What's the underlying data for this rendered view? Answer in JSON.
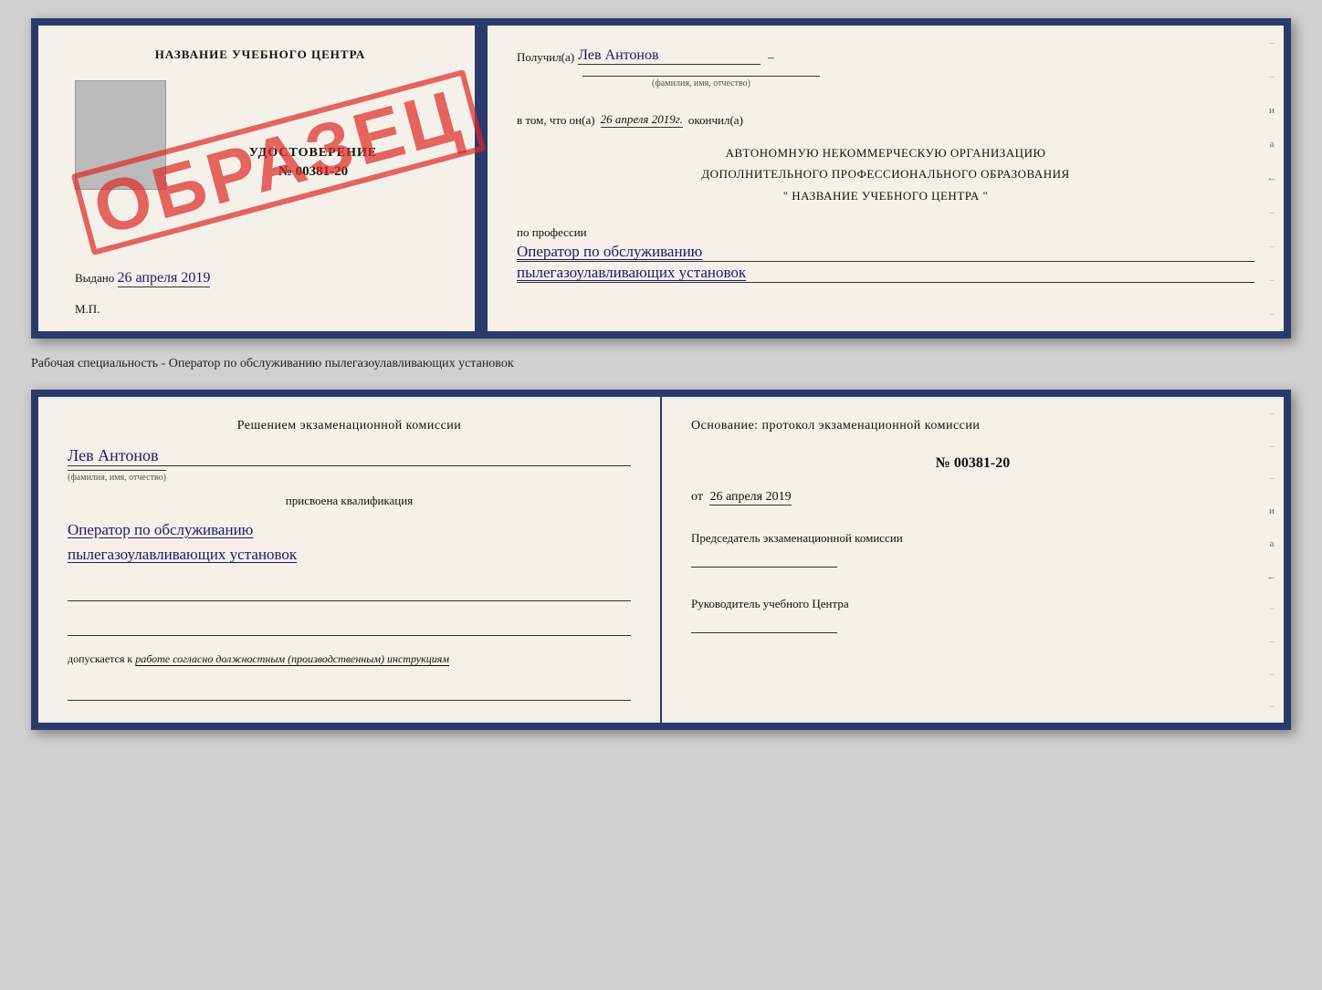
{
  "top_certificate": {
    "left_page": {
      "header": "НАЗВАНИЕ УЧЕБНОГО ЦЕНТРА",
      "photo_alt": "фото",
      "cert_title": "УДОСТОВЕРЕНИЕ",
      "cert_number": "№ 00381-20",
      "issued_label": "Выдано",
      "issued_date": "26 апреля 2019",
      "mp_label": "М.П.",
      "obrazets": "ОБРАЗЕЦ"
    },
    "right_page": {
      "received_prefix": "Получил(а)",
      "recipient_name": "Лев Антонов",
      "name_field_label": "(фамилия, имя, отчество)",
      "in_that_prefix": "в том, что он(а)",
      "completion_date": "26 апреля 2019г.",
      "completion_label": "окончил(а)",
      "org_line1": "АВТОНОМНУЮ НЕКОММЕРЧЕСКУЮ ОРГАНИЗАЦИЮ",
      "org_line2": "ДОПОЛНИТЕЛЬНОГО ПРОФЕССИОНАЛЬНОГО ОБРАЗОВАНИЯ",
      "org_line3": "\"   НАЗВАНИЕ УЧЕБНОГО ЦЕНТРА   \"",
      "profession_prefix": "по профессии",
      "profession_line1": "Оператор по обслуживанию",
      "profession_line2": "пылегазоулавливающих установок"
    }
  },
  "separator": {
    "text": "Рабочая специальность - Оператор по обслуживанию пылегазоулавливающих установок"
  },
  "bottom_certificate": {
    "left_page": {
      "commission_text": "Решением экзаменационной комиссии",
      "person_name": "Лев Антонов",
      "name_field_label": "(фамилия, имя, отчество)",
      "assigned_label": "присвоена квалификация",
      "qualification_line1": "Оператор по обслуживанию",
      "qualification_line2": "пылегазоулавливающих установок",
      "allowed_prefix": "допускается к",
      "allowed_italic": "работе согласно должностным (производственным) инструкциям"
    },
    "right_page": {
      "basis_label": "Основание: протокол экзаменационной комиссии",
      "protocol_number": "№  00381-20",
      "protocol_date_prefix": "от",
      "protocol_date": "26 апреля 2019",
      "chairman_label": "Председатель экзаменационной комиссии",
      "head_label": "Руководитель учебного Центра"
    }
  },
  "side_chars": {
    "u_char": "и",
    "a_char": "а",
    "left_arrow": "←"
  }
}
